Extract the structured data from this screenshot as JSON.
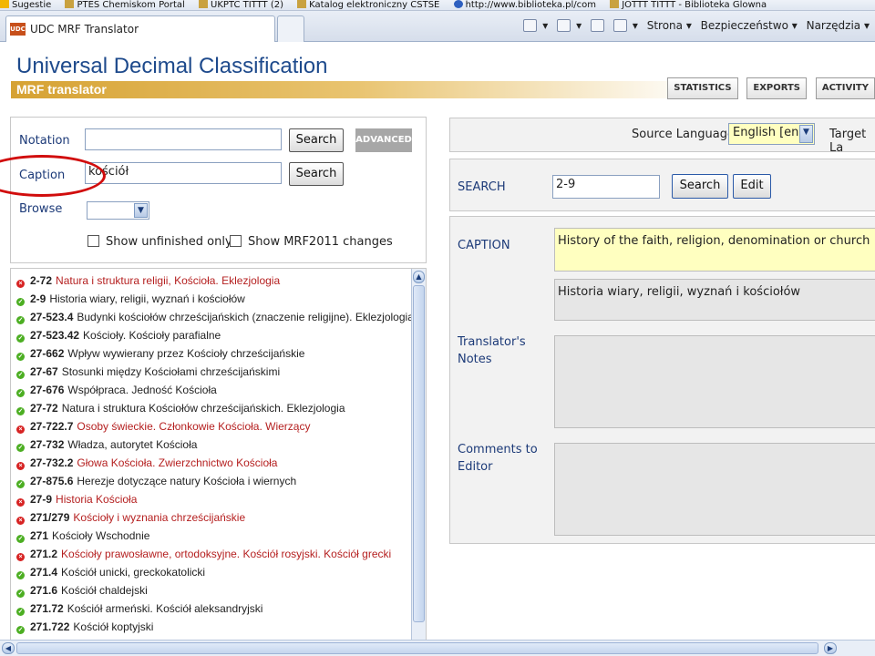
{
  "browser": {
    "favorites": [
      {
        "label": "Sugestie",
        "icon": "star-icon"
      },
      {
        "label": "PTES Chemiskom Portal",
        "icon": "page-icon"
      },
      {
        "label": "UKPTC TITTT (2)",
        "icon": "page-icon"
      },
      {
        "label": "Katalog elektroniczny CSTSE",
        "icon": "page-icon"
      },
      {
        "label": "http://www.biblioteka.pl/com",
        "icon": "ie-icon"
      },
      {
        "label": "JOTTT TITTT - Biblioteka Glowna",
        "icon": "page-icon"
      }
    ],
    "tab_title": "UDC MRF Translator",
    "tab_badge": "UDC",
    "commands": {
      "page": "Strona",
      "security": "Bezpieczeństwo",
      "tools": "Narzędzia"
    }
  },
  "header": {
    "title": "Universal Decimal Classification",
    "subtitle": "MRF translator",
    "nav": [
      "STATISTICS",
      "EXPORTS",
      "ACTIVITY"
    ]
  },
  "search_panel": {
    "notation_label": "Notation",
    "notation_value": "",
    "caption_label": "Caption",
    "caption_value": "kościół",
    "browse_label": "Browse",
    "search_button": "Search",
    "advanced_button": "ADVANCED",
    "unfinished_label": "Show unfinished only",
    "changes_label": "Show MRF2011 changes"
  },
  "results": [
    {
      "code": "2-72",
      "caption": "Natura i struktura religii, Kościoła. Eklezjologia",
      "status": "err"
    },
    {
      "code": "2-9",
      "caption": "Historia wiary, religii, wyznań i kościołów",
      "status": "ok"
    },
    {
      "code": "27-523.4",
      "caption": "Budynki kościołów chrześcijańskich (znaczenie religijne). Eklezjologia",
      "status": "ok"
    },
    {
      "code": "27-523.42",
      "caption": "Kościoły. Kościoły parafialne",
      "status": "ok"
    },
    {
      "code": "27-662",
      "caption": "Wpływ wywierany przez Kościoły chrześcijańskie",
      "status": "ok"
    },
    {
      "code": "27-67",
      "caption": "Stosunki między Kościołami chrześcijańskimi",
      "status": "ok"
    },
    {
      "code": "27-676",
      "caption": "Współpraca. Jedność Kościoła",
      "status": "ok"
    },
    {
      "code": "27-72",
      "caption": "Natura i struktura Kościołów chrześcijańskich. Eklezjologia",
      "status": "ok"
    },
    {
      "code": "27-722.7",
      "caption": "Osoby świeckie. Członkowie Kościoła. Wierzący",
      "status": "err"
    },
    {
      "code": "27-732",
      "caption": "Władza, autorytet Kościoła",
      "status": "ok"
    },
    {
      "code": "27-732.2",
      "caption": "Głowa Kościoła. Zwierzchnictwo Kościoła",
      "status": "err"
    },
    {
      "code": "27-875.6",
      "caption": "Herezje dotyczące natury Kościoła i wiernych",
      "status": "ok"
    },
    {
      "code": "27-9",
      "caption": "Historia Kościoła",
      "status": "err"
    },
    {
      "code": "271/279",
      "caption": "Kościoły i wyznania chrześcijańskie",
      "status": "err"
    },
    {
      "code": "271",
      "caption": "Kościoły Wschodnie",
      "status": "ok"
    },
    {
      "code": "271.2",
      "caption": "Kościoły prawosławne, ortodoksyjne. Kościół rosyjski. Kościół grecki",
      "status": "err"
    },
    {
      "code": "271.4",
      "caption": "Kościół unicki, greckokatolicki",
      "status": "ok"
    },
    {
      "code": "271.6",
      "caption": "Kościół chaldejski",
      "status": "ok"
    },
    {
      "code": "271.72",
      "caption": "Kościół armeński. Kościół aleksandryjski",
      "status": "ok"
    },
    {
      "code": "271.722",
      "caption": "Kościół koptyjski",
      "status": "ok"
    }
  ],
  "editor": {
    "source_language_label": "Source Language",
    "source_language_value": "English [en]",
    "target_language_label": "Target La",
    "search_label": "SEARCH",
    "search_value": "2-9",
    "search_button": "Search",
    "edit_button": "Edit",
    "caption_label": "CAPTION",
    "caption_source": "History of the faith, religion, denomination or church",
    "caption_target": "Historia wiary, religii, wyznań i kościołów",
    "notes_label": "Translator's Notes",
    "comments_label": "Comments to Editor"
  },
  "colors": {
    "accent": "#1e4a8c",
    "highlight": "#ffffc0",
    "ok": "#4cae22",
    "err": "#d72323"
  }
}
